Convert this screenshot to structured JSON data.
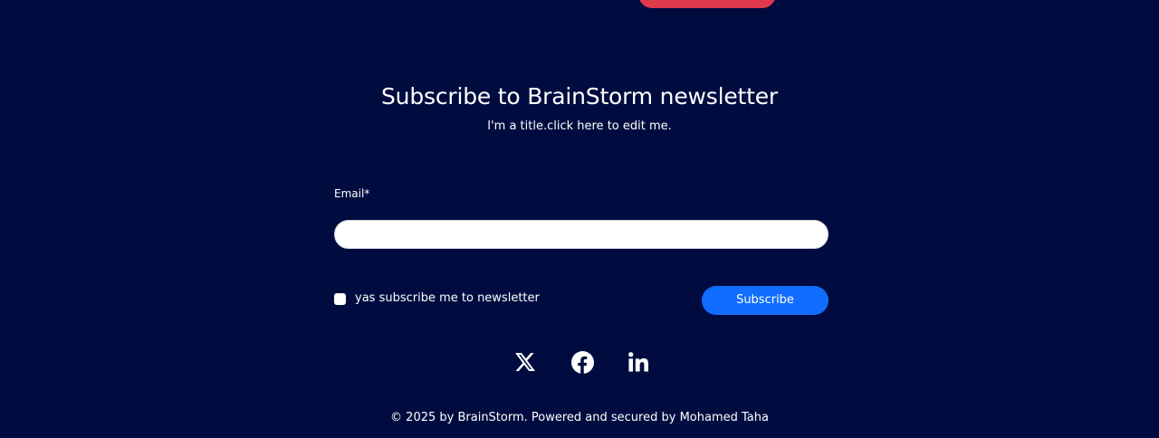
{
  "newsletter": {
    "title": "Subscribe to BrainStorm newsletter",
    "subtitle": "I'm a title.click here to edit me.",
    "email_label": "Email*",
    "email_value": "",
    "email_placeholder": "",
    "consent_label": "yas subscribe me to newsletter",
    "consent_checked": false,
    "subscribe_label": "Subscribe"
  },
  "social": [
    {
      "icon": "x-icon",
      "network": "X"
    },
    {
      "icon": "facebook-icon",
      "network": "Facebook"
    },
    {
      "icon": "linkedin-icon",
      "network": "LinkedIn"
    }
  ],
  "footer": {
    "copyright": "© 2025 by BrainStorm. Powered and secured by Mohamed Taha"
  },
  "colors": {
    "background": "#000c3f",
    "accent_button": "#116dff",
    "top_button": "#e0384c",
    "text": "#ffffff"
  }
}
